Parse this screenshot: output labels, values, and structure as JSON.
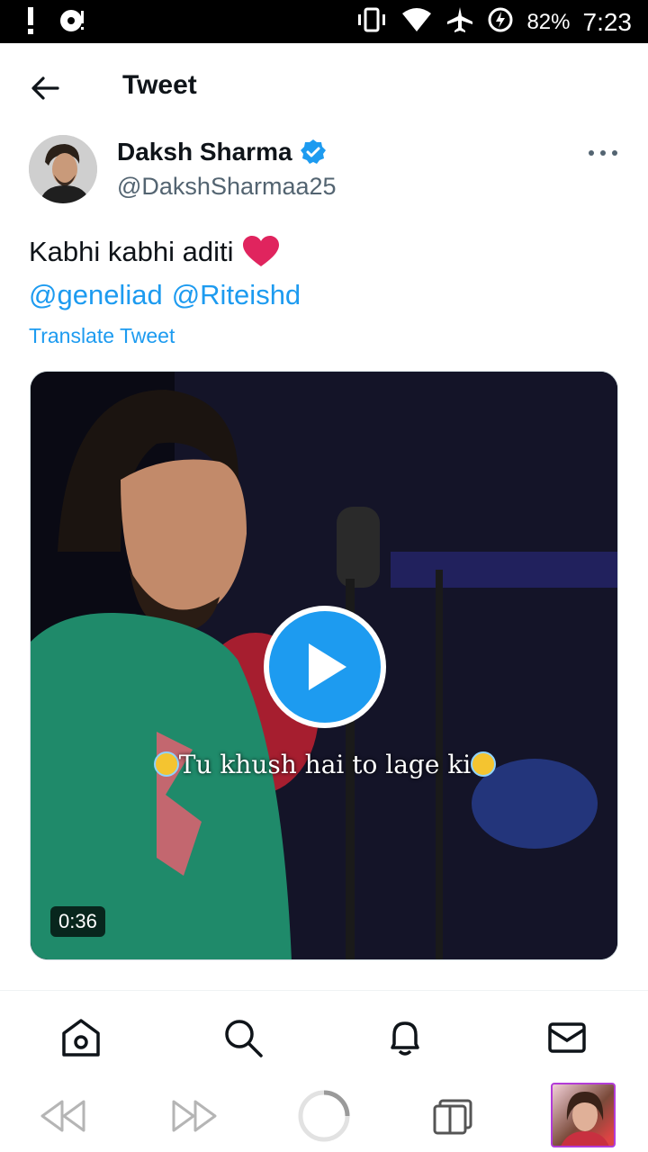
{
  "status_bar": {
    "battery_percent": "82%",
    "time": "7:23",
    "icons": [
      "alert-icon",
      "media-icon",
      "vibrate-icon",
      "wifi-icon",
      "airplane-icon",
      "battery-charging-icon"
    ]
  },
  "header": {
    "title": "Tweet",
    "back_icon": "arrow-left-icon"
  },
  "tweet": {
    "author_name": "Daksh Sharma",
    "author_handle": "@DakshSharmaa25",
    "verified": true,
    "text": "Kabhi kabhi aditi",
    "text_emoji": "red-heart",
    "mentions": [
      "@geneliad",
      "@Riteishd"
    ],
    "translate_label": "Translate Tweet",
    "video": {
      "caption": "Tu khush hai to lage ki",
      "duration": "0:36"
    }
  },
  "bottom_nav": {
    "items": [
      "home-icon",
      "search-icon",
      "notifications-icon",
      "messages-icon"
    ]
  },
  "system_bar": {
    "items": [
      "rewind-icon",
      "fast-forward-icon",
      "loading-icon",
      "tabs-icon",
      "thumbnail"
    ]
  },
  "colors": {
    "accent": "#1d9bf0",
    "text": "#0f1419",
    "secondary_text": "#536471",
    "heart": "#e0245e"
  }
}
